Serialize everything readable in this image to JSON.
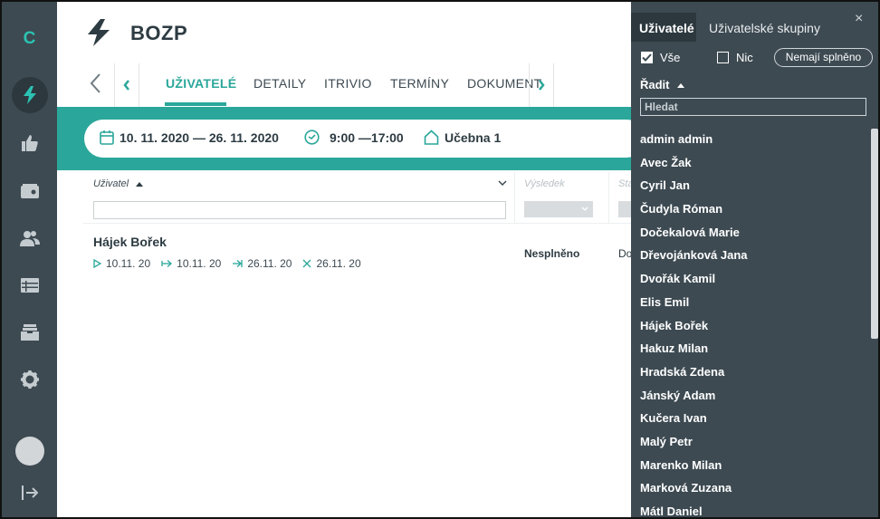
{
  "app": {
    "logo": "C",
    "title": "BOZP"
  },
  "nav": {
    "items": [
      "lightning-icon",
      "thumbs-up-icon",
      "card-icon",
      "users-icon",
      "table-icon",
      "inbox-icon",
      "gear-icon",
      "logout-icon"
    ]
  },
  "tabs": [
    {
      "label": "UŽIVATELÉ",
      "active": true
    },
    {
      "label": "DETAILY"
    },
    {
      "label": "ITRIVIO"
    },
    {
      "label": "TERMÍNY"
    },
    {
      "label": "DOKUMENT"
    }
  ],
  "event": {
    "date_range": "10. 11. 2020 — 26. 11. 2020",
    "time_range": "9:00 —17:00",
    "location": "Učebna 1"
  },
  "table": {
    "columns": {
      "user": "Uživatel",
      "result": "Výsledek",
      "status": "Sta"
    },
    "rows": [
      {
        "name": "Hájek Bořek",
        "dates": [
          "10.11. 20",
          "10.11. 20",
          "26.11. 20",
          "26.11. 20"
        ],
        "result": "Nesplněno",
        "status": "Do"
      }
    ]
  },
  "panel": {
    "tab_users": "Uživatelé",
    "tab_groups": "Uživatelské skupiny",
    "close": "×",
    "check_all": "Vše",
    "check_none": "Nic",
    "not_done_button": "Nemají splněno",
    "sort_label": "Řadit",
    "search_placeholder": "Hledat",
    "users": [
      "admin admin",
      "Avec Žak",
      "Cyril Jan",
      "Čudyla Róman",
      "Dočekalová Marie",
      "Dřevojánková Jana",
      "Dvořák Kamil",
      "Elis Emil",
      "Hájek Bořek",
      "Hakuz Milan",
      "Hradská Zdena",
      "Jánský Adam",
      "Kučera Ivan",
      "Malý Petr",
      "Marenko Milan",
      "Marková Zuzana",
      "Mátl Daniel"
    ]
  },
  "colors": {
    "accent": "#2aa79a",
    "nav_bg": "#3d4a52",
    "panel_bg": "#3d4a52"
  }
}
